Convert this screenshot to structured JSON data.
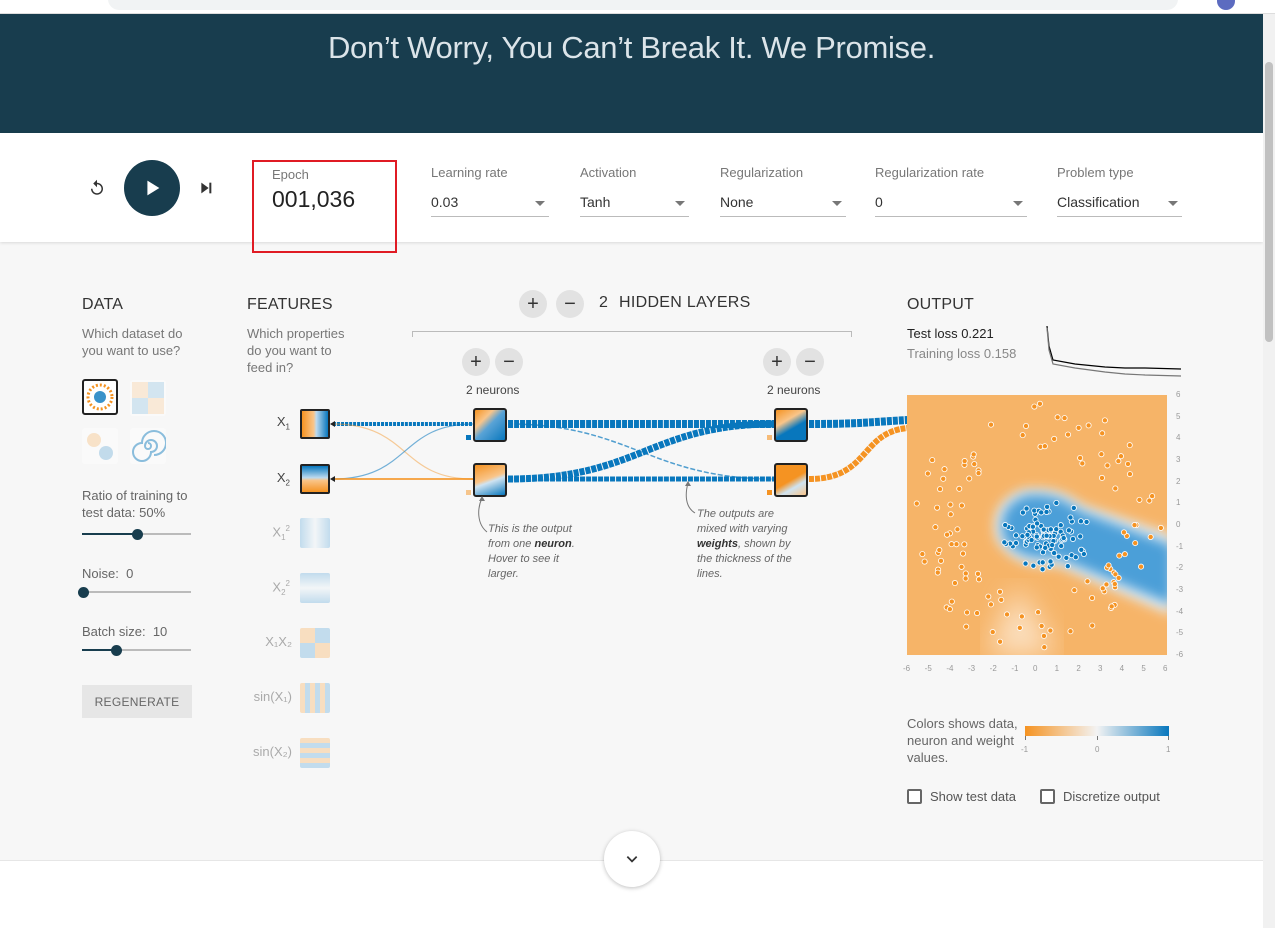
{
  "header": {
    "tagline": "Don’t Worry, You Can’t Break It. We Promise."
  },
  "controls": {
    "reset_icon": "reset-icon",
    "play_icon": "play-icon",
    "step_icon": "step-icon",
    "epoch_label": "Epoch",
    "epoch_value": "001,036",
    "learning_rate": {
      "label": "Learning rate",
      "value": "0.03"
    },
    "activation": {
      "label": "Activation",
      "value": "Tanh"
    },
    "regularization": {
      "label": "Regularization",
      "value": "None"
    },
    "regularization_rate": {
      "label": "Regularization rate",
      "value": "0"
    },
    "problem_type": {
      "label": "Problem type",
      "value": "Classification"
    }
  },
  "data_panel": {
    "title": "DATA",
    "question": "Which dataset do you want to use?",
    "ratio_label": "Ratio of training to test data:",
    "ratio_value": "50%",
    "ratio_fraction": 0.5,
    "noise_label": "Noise:",
    "noise_value": "0",
    "noise_fraction": 0.0,
    "batch_label": "Batch size:",
    "batch_value": "10",
    "batch_fraction": 0.3,
    "regenerate": "REGENERATE"
  },
  "features_panel": {
    "title": "FEATURES",
    "question": "Which properties do you want to feed in?",
    "features": [
      {
        "base": "X",
        "sub": "1",
        "sup": "",
        "active": true
      },
      {
        "base": "X",
        "sub": "2",
        "sup": "",
        "active": true
      },
      {
        "base": "X",
        "sub": "1",
        "sup": "2",
        "active": false
      },
      {
        "base": "X",
        "sub": "2",
        "sup": "2",
        "active": false
      },
      {
        "base": "X₁X₂",
        "sub": "",
        "sup": "",
        "active": false
      },
      {
        "base": "sin(X₁)",
        "sub": "",
        "sup": "",
        "active": false
      },
      {
        "base": "sin(X₂)",
        "sub": "",
        "sup": "",
        "active": false
      }
    ]
  },
  "network": {
    "hidden_layers_count": "2",
    "hidden_layers_label": "HIDDEN LAYERS",
    "layer1_neurons": "2 neurons",
    "layer2_neurons": "2 neurons",
    "annotation_neuron_pre": "This is the output from one ",
    "annotation_neuron_bold": "neuron",
    "annotation_neuron_post": ". Hover to see it larger.",
    "annotation_weights_pre": "The outputs are mixed with varying ",
    "annotation_weights_bold": "weights",
    "annotation_weights_post": ", shown by the thickness of the lines."
  },
  "output_panel": {
    "title": "OUTPUT",
    "test_loss_label": "Test loss",
    "test_loss": "0.221",
    "training_loss_label": "Training loss",
    "training_loss": "0.158",
    "y_ticks": [
      "6",
      "5",
      "4",
      "3",
      "2",
      "1",
      "0",
      "-1",
      "-2",
      "-3",
      "-4",
      "-5",
      "-6"
    ],
    "x_ticks": [
      "-6",
      "-5",
      "-4",
      "-3",
      "-2",
      "-1",
      "0",
      "1",
      "2",
      "3",
      "4",
      "5",
      "6"
    ],
    "legend_text": "Colors shows data, neuron and weight values.",
    "legend_min": "-1",
    "legend_mid": "0",
    "legend_max": "1",
    "show_test_data": "Show test data",
    "discretize_output": "Discretize output"
  },
  "colors": {
    "orange": "#f59322",
    "blue": "#0877bd",
    "dark": "#183d4e",
    "highlight": "#e01b24"
  }
}
